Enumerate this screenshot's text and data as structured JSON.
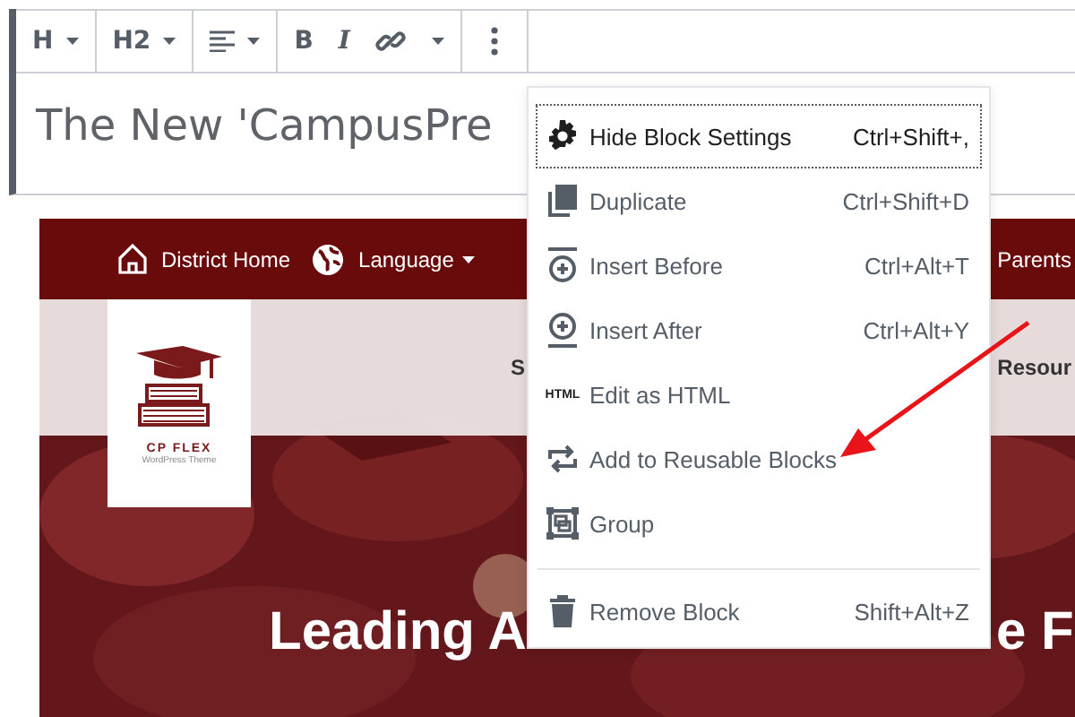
{
  "toolbar": {
    "groups": [
      {
        "buttons": [
          {
            "kind": "text",
            "label": "H",
            "dropdown": true
          }
        ]
      },
      {
        "buttons": [
          {
            "kind": "text",
            "label": "H2",
            "dropdown": true
          }
        ]
      },
      {
        "buttons": [
          {
            "kind": "align",
            "dropdown": true
          }
        ]
      },
      {
        "buttons": [
          {
            "kind": "text",
            "label": "B",
            "dropdown": false
          },
          {
            "kind": "italic",
            "label": "I",
            "dropdown": false
          },
          {
            "kind": "link",
            "dropdown": false
          },
          {
            "kind": "caret",
            "dropdown": false
          }
        ]
      },
      {
        "buttons": [
          {
            "kind": "more",
            "dropdown": false
          }
        ]
      }
    ]
  },
  "editor": {
    "title": "The New 'CampusPre"
  },
  "preview": {
    "nav": [
      {
        "kind": "home",
        "label": "District Home"
      },
      {
        "kind": "globe",
        "label": "Language",
        "dropdown": true
      },
      {
        "kind": "plain",
        "label": "Parents"
      }
    ],
    "subnav": [
      "S",
      "Resour"
    ],
    "logo": {
      "name": "CP FLEX",
      "tagline": "WordPress Theme"
    },
    "headline": [
      "Leading A",
      "e F"
    ]
  },
  "menu": {
    "items": [
      {
        "label": "Hide Block Settings",
        "shortcut": "Ctrl+Shift+,",
        "focused": true,
        "divider_before": false
      },
      {
        "label": "Duplicate",
        "shortcut": "Ctrl+Shift+D",
        "focused": false,
        "divider_before": false
      },
      {
        "label": "Insert Before",
        "shortcut": "Ctrl+Alt+T",
        "focused": false,
        "divider_before": false
      },
      {
        "label": "Insert After",
        "shortcut": "Ctrl+Alt+Y",
        "focused": false,
        "divider_before": false
      },
      {
        "label": "Edit as HTML",
        "icon_text": "HTML",
        "focused": false,
        "divider_before": false
      },
      {
        "label": "Add to Reusable Blocks",
        "focused": false,
        "divider_before": false
      },
      {
        "label": "Group",
        "focused": false,
        "divider_before": false
      },
      {
        "label": "Remove Block",
        "shortcut": "Shift+Alt+Z",
        "focused": false,
        "divider_before": true
      }
    ]
  }
}
